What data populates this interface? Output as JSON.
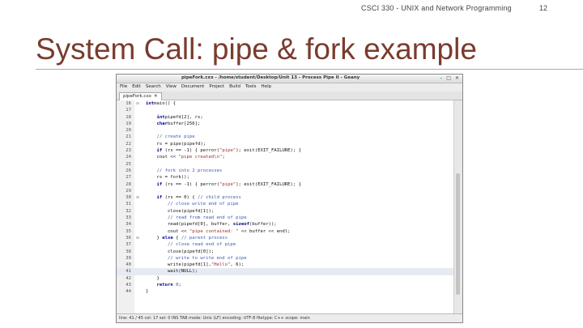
{
  "slide": {
    "header": "CSCI 330 - UNIX and Network Programming",
    "page_number": "12",
    "title": "System Call: pipe & fork example"
  },
  "window": {
    "title": "pipeFork.cxx - /home/student/Desktop/Unit 13 - Process Pipe II - Geany",
    "buttons": [
      "–",
      "□",
      "✕"
    ],
    "menu": [
      "File",
      "Edit",
      "Search",
      "View",
      "Document",
      "Project",
      "Build",
      "Tools",
      "Help"
    ],
    "tab": {
      "label": "pipeFork.cxx",
      "close": "✕"
    },
    "status": "line: 41 / 45    col: 17    sel: 0    INS    TAB    mode: Unix (LF)    encoding: UTF-8    filetype: C++    scope: main"
  },
  "code": {
    "current_line": "41",
    "lines": [
      {
        "n": "16",
        "fold": "⊟",
        "segs": [
          [
            "kw",
            "int"
          ],
          [
            "",
            "main() {"
          ]
        ]
      },
      {
        "n": "17",
        "fold": "",
        "segs": []
      },
      {
        "n": "18",
        "fold": "",
        "segs": [
          [
            "",
            "    "
          ],
          [
            "kw",
            "int"
          ],
          [
            "",
            "pipefd[2], rs;"
          ]
        ]
      },
      {
        "n": "19",
        "fold": "",
        "segs": [
          [
            "",
            "    "
          ],
          [
            "kw",
            "char"
          ],
          [
            "",
            "buffer[256];"
          ]
        ]
      },
      {
        "n": "20",
        "fold": "",
        "segs": []
      },
      {
        "n": "21",
        "fold": "",
        "segs": [
          [
            "cm",
            "    // create pipe"
          ]
        ]
      },
      {
        "n": "22",
        "fold": "",
        "segs": [
          [
            "",
            "    rs = pipe(pipefd);"
          ]
        ]
      },
      {
        "n": "23",
        "fold": "",
        "segs": [
          [
            "",
            "    "
          ],
          [
            "kw",
            "if"
          ],
          [
            "",
            " (rs == -1) { perror("
          ],
          [
            "str",
            "\"pipe\""
          ],
          [
            "",
            "); exit(EXIT_FAILURE); }"
          ]
        ]
      },
      {
        "n": "24",
        "fold": "",
        "segs": [
          [
            "",
            "    cout << "
          ],
          [
            "str",
            "\"pipe created\\n\""
          ],
          [
            "",
            ";"
          ]
        ]
      },
      {
        "n": "25",
        "fold": "",
        "segs": []
      },
      {
        "n": "26",
        "fold": "",
        "segs": [
          [
            "cm",
            "    // fork into 2 processes"
          ]
        ]
      },
      {
        "n": "27",
        "fold": "",
        "segs": [
          [
            "",
            "    rs = fork();"
          ]
        ]
      },
      {
        "n": "28",
        "fold": "",
        "segs": [
          [
            "",
            "    "
          ],
          [
            "kw",
            "if"
          ],
          [
            "",
            " (rs == -1) { perror("
          ],
          [
            "str",
            "\"pipe\""
          ],
          [
            "",
            "); exit(EXIT_FAILURE); }"
          ]
        ]
      },
      {
        "n": "29",
        "fold": "",
        "segs": []
      },
      {
        "n": "30",
        "fold": "⊟",
        "segs": [
          [
            "",
            "    "
          ],
          [
            "kw",
            "if"
          ],
          [
            "",
            " (rs == 0) { "
          ],
          [
            "cm",
            "// child process"
          ]
        ]
      },
      {
        "n": "31",
        "fold": "",
        "segs": [
          [
            "cm",
            "        // close write end of pipe"
          ]
        ]
      },
      {
        "n": "32",
        "fold": "",
        "segs": [
          [
            "",
            "        close(pipefd[1]);"
          ]
        ]
      },
      {
        "n": "33",
        "fold": "",
        "segs": [
          [
            "cm",
            "        // read from read end of pipe"
          ]
        ]
      },
      {
        "n": "34",
        "fold": "",
        "segs": [
          [
            "",
            "        read(pipefd[0], buffer, "
          ],
          [
            "kw",
            "sizeof"
          ],
          [
            "",
            "(buffer));"
          ]
        ]
      },
      {
        "n": "35",
        "fold": "",
        "segs": [
          [
            "",
            "        cout << "
          ],
          [
            "str",
            "\"pipe contained: \""
          ],
          [
            "",
            " << buffer << endl;"
          ]
        ]
      },
      {
        "n": "36",
        "fold": "⊟",
        "segs": [
          [
            "",
            "    } "
          ],
          [
            "kw",
            "else"
          ],
          [
            "",
            " { "
          ],
          [
            "cm",
            "// parent process"
          ]
        ]
      },
      {
        "n": "37",
        "fold": "",
        "segs": [
          [
            "cm",
            "        // close read end of pipe"
          ]
        ]
      },
      {
        "n": "38",
        "fold": "",
        "segs": [
          [
            "",
            "        close(pipefd[0]);"
          ]
        ]
      },
      {
        "n": "39",
        "fold": "",
        "segs": [
          [
            "cm",
            "        // write to write end of pipe"
          ]
        ]
      },
      {
        "n": "40",
        "fold": "",
        "segs": [
          [
            "",
            "        write(pipefd[1],"
          ],
          [
            "str",
            "\"Hello\""
          ],
          [
            "",
            ", 6);"
          ]
        ]
      },
      {
        "n": "41",
        "fold": "",
        "segs": [
          [
            "",
            "        wait(NULL);"
          ]
        ]
      },
      {
        "n": "42",
        "fold": "",
        "segs": [
          [
            "",
            "    }"
          ]
        ]
      },
      {
        "n": "43",
        "fold": "",
        "segs": [
          [
            "",
            "    "
          ],
          [
            "kw",
            "return"
          ],
          [
            "",
            " "
          ],
          [
            "num",
            "0"
          ],
          [
            "",
            ";"
          ]
        ]
      },
      {
        "n": "44",
        "fold": "",
        "segs": [
          [
            "",
            "}"
          ]
        ]
      }
    ]
  }
}
